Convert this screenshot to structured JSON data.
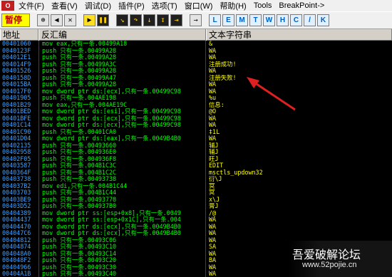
{
  "menu": {
    "logo": "O",
    "items": [
      "文件(F)",
      "查看(V)",
      "调试(D)",
      "插件(P)",
      "选项(T)",
      "窗口(W)",
      "帮助(H)",
      "Tools",
      "BreakPoint->"
    ]
  },
  "toolbar": {
    "status": "暂停",
    "buttons": [
      "open",
      "restart",
      "close",
      "run",
      "pause",
      "step-into",
      "step-over",
      "trace-into",
      "trace-over",
      "execute-till-return",
      "go-to"
    ],
    "letters": [
      "L",
      "E",
      "M",
      "T",
      "W",
      "H",
      "C",
      "/",
      "K"
    ]
  },
  "columns": {
    "address": "地址",
    "disasm": "反汇编",
    "strings": "文本字符串"
  },
  "rows": [
    {
      "addr": "00401060",
      "code": "mov eax,只有一条.00499A18",
      "str": "&"
    },
    {
      "addr": "0040123F",
      "code": "push 只有一条.00499A28",
      "str": "WA"
    },
    {
      "addr": "004012E1",
      "code": "push 只有一条.00499A28",
      "str": "WA"
    },
    {
      "addr": "004014F9",
      "code": "push 只有一条.00499A3C",
      "str": "注册成功!"
    },
    {
      "addr": "00401526",
      "code": "push 只有一条.00499A28",
      "str": "WA"
    },
    {
      "addr": "0040158D",
      "code": "push 只有一条.00499A47",
      "str": "注册失败!"
    },
    {
      "addr": "004015BA",
      "code": "push 只有一条.00499A28",
      "str": "WA"
    },
    {
      "addr": "004017F0",
      "code": "mov dword ptr ds:[ecx],只有一条.00499C98",
      "str": "WA"
    },
    {
      "addr": "00401905",
      "code": "push 只有一条.004AE198",
      "str": "%u"
    },
    {
      "addr": "00401B29",
      "code": "mov eax,只有一条.004AE19C",
      "str": "信息:"
    },
    {
      "addr": "00401BED",
      "code": "mov dword ptr ds:[esi],只有一条.00499C98",
      "str": "@Ô"
    },
    {
      "addr": "00401BFE",
      "code": "mov dword ptr ds:[ecx],只有一条.00499C98",
      "str": "WA"
    },
    {
      "addr": "00401C14",
      "code": "mov dword ptr ds:[ecx],只有一条.00499C98",
      "str": "WA"
    },
    {
      "addr": "00401C90",
      "code": "push 只有一条.00401CA0",
      "str": "‡1L"
    },
    {
      "addr": "00401D04",
      "code": "mov dword ptr ds:[eax],只有一条.0049B4B0",
      "str": "WA"
    },
    {
      "addr": "00402135",
      "code": "push 只有一条.00493660",
      "str": "辅J"
    },
    {
      "addr": "00402958",
      "code": "push 只有一条.004936E0",
      "str": "辅J"
    },
    {
      "addr": "00402F05",
      "code": "push 只有一条.004936F8",
      "str": "旺J"
    },
    {
      "addr": "00403587",
      "code": "push 只有一条.004B1C3C",
      "str": "EDIT"
    },
    {
      "addr": "0040364F",
      "code": "push 只有一条.004B1C2C",
      "str": "msctls_updown32"
    },
    {
      "addr": "00403738",
      "code": "push 只有一条.00493738",
      "str": "衍\\J"
    },
    {
      "addr": "004037B2",
      "code": "mov edi,只有一条.004B1C44",
      "str": "冥"
    },
    {
      "addr": "00403703",
      "code": "push 只有一条.004B1C44",
      "str": "冥"
    },
    {
      "addr": "00403BE9",
      "code": "push 只有一条.00493778",
      "str": "x\\J"
    },
    {
      "addr": "00403D52",
      "code": "push 只有一条.004937B0",
      "str": "膏J"
    },
    {
      "addr": "00404389",
      "code": "mov dword ptr ss:[esp+0x8],只有一条.0049",
      "str": "/@"
    },
    {
      "addr": "00404437",
      "code": "mov dword ptr ss:[esp+0x1C],只有一条.004",
      "str": "WA"
    },
    {
      "addr": "00404470",
      "code": "mov dword ptr ds:[ecx],只有一条.0049B4B0",
      "str": "WA"
    },
    {
      "addr": "004047C6",
      "code": "mov dword ptr ds:[ecx],只有一条.0049B4B0",
      "str": "WA"
    },
    {
      "addr": "00404812",
      "code": "push 只有一条.00493C06",
      "str": "WA"
    },
    {
      "addr": "00404874",
      "code": "push 只有一条.00493C10",
      "str": "SA"
    },
    {
      "addr": "004048A0",
      "code": "push 只有一条.00493C14",
      "str": "WA"
    },
    {
      "addr": "004048F2",
      "code": "push 只有一条.00493C20",
      "str": "BA"
    },
    {
      "addr": "00404966",
      "code": "push 只有一条.00493C30",
      "str": "WA"
    },
    {
      "addr": "00404A1B",
      "code": "push 只有一条.00493C40",
      "str": "WA"
    }
  ],
  "watermark": {
    "title": "吾爱破解论坛",
    "url": "www.52pojie.cn"
  },
  "colors": {
    "address": "#40a0ff",
    "code": "#00ff00",
    "string": "#ffff00",
    "arrow": "#e02020"
  }
}
